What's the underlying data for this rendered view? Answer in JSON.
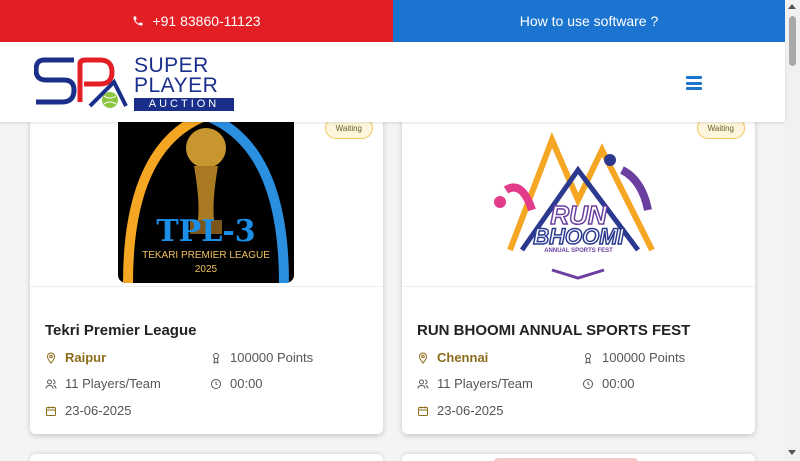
{
  "topbar": {
    "phone": "+91 83860-11123",
    "help": "How to use software ?"
  },
  "logo": {
    "line1": "SUPER",
    "line2": "PLAYER",
    "line3": "AUCTION"
  },
  "colors": {
    "accent_red": "#e31e24",
    "accent_blue": "#1b74d0",
    "brand_navy": "#1a2f8a",
    "city_gold": "#8a6d1a"
  },
  "cards": [
    {
      "status": "Waiting",
      "title": "Tekri Premier League",
      "city": "Raipur",
      "points": "100000 Points",
      "players": "11 Players/Team",
      "time": "00:00",
      "date": "23-06-2025",
      "image": {
        "line1": "TPL-3",
        "line2": "TEKARI PREMIER LEAGUE",
        "line3": "2025"
      }
    },
    {
      "status": "Waiting",
      "title": "RUN BHOOMI ANNUAL SPORTS FEST",
      "city": "Chennai",
      "points": "100000 Points",
      "players": "11 Players/Team",
      "time": "00:00",
      "date": "23-06-2025",
      "image": {
        "line1": "RUN",
        "line2": "BHOOMI",
        "line3": "ANNUAL SPORTS FEST"
      }
    }
  ]
}
